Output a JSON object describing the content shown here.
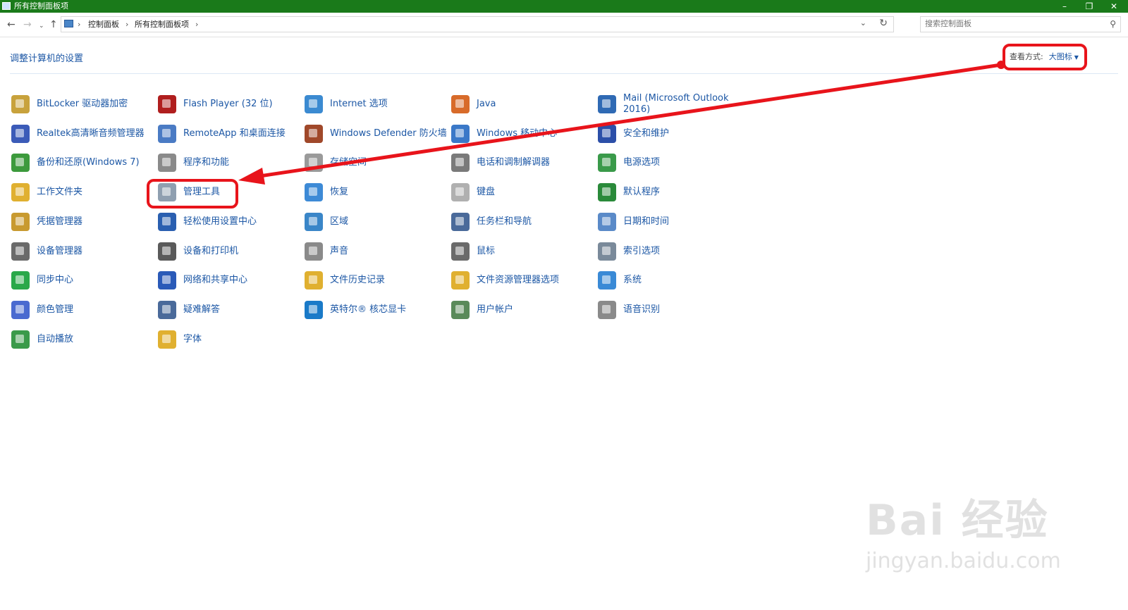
{
  "window": {
    "title": "所有控制面板项"
  },
  "address": {
    "crumbs": [
      "控制面板",
      "所有控制面板项"
    ],
    "separator": "›"
  },
  "search": {
    "placeholder": "搜索控制面板"
  },
  "header": {
    "heading": "调整计算机的设置",
    "view_by_label": "查看方式:",
    "view_by_value": "大图标"
  },
  "items": [
    {
      "label": "BitLocker 驱动器加密",
      "icon": "bitlocker-icon",
      "color": "#c8a23c"
    },
    {
      "label": "Flash Player (32 位)",
      "icon": "flash-icon",
      "color": "#b01e1e"
    },
    {
      "label": "Internet 选项",
      "icon": "internet-options-icon",
      "color": "#3b8ad1"
    },
    {
      "label": "Java",
      "icon": "java-icon",
      "color": "#d86b2a"
    },
    {
      "label": "Mail (Microsoft Outlook 2016)",
      "icon": "mail-icon",
      "color": "#2f6ab4"
    },
    {
      "label": "Realtek高清晰音频管理器",
      "icon": "realtek-audio-icon",
      "color": "#3b5bb8"
    },
    {
      "label": "RemoteApp 和桌面连接",
      "icon": "remoteapp-icon",
      "color": "#4a7bc4"
    },
    {
      "label": "Windows Defender 防火墙",
      "icon": "firewall-icon",
      "color": "#a0482a"
    },
    {
      "label": "Windows 移动中心",
      "icon": "mobility-center-icon",
      "color": "#3a78c8"
    },
    {
      "label": "安全和维护",
      "icon": "security-flag-icon",
      "color": "#2c4fa8"
    },
    {
      "label": "备份和还原(Windows 7)",
      "icon": "backup-icon",
      "color": "#3c9a3c"
    },
    {
      "label": "程序和功能",
      "icon": "programs-icon",
      "color": "#8a8a8a"
    },
    {
      "label": "存储空间",
      "icon": "storage-spaces-icon",
      "color": "#9a9a9a"
    },
    {
      "label": "电话和调制解调器",
      "icon": "phone-modem-icon",
      "color": "#7a7a7a"
    },
    {
      "label": "电源选项",
      "icon": "power-options-icon",
      "color": "#3a9a4a"
    },
    {
      "label": "工作文件夹",
      "icon": "work-folders-icon",
      "color": "#e0b030"
    },
    {
      "label": "管理工具",
      "icon": "admin-tools-icon",
      "color": "#8f9fb0"
    },
    {
      "label": "恢复",
      "icon": "recovery-icon",
      "color": "#3d8ad6"
    },
    {
      "label": "键盘",
      "icon": "keyboard-icon",
      "color": "#b0b0b0"
    },
    {
      "label": "默认程序",
      "icon": "default-programs-icon",
      "color": "#2a8a3a"
    },
    {
      "label": "凭据管理器",
      "icon": "credential-manager-icon",
      "color": "#c89a30"
    },
    {
      "label": "轻松使用设置中心",
      "icon": "ease-of-access-icon",
      "color": "#2a5fb0"
    },
    {
      "label": "区域",
      "icon": "region-icon",
      "color": "#3a86c8"
    },
    {
      "label": "任务栏和导航",
      "icon": "taskbar-icon",
      "color": "#4a6a9a"
    },
    {
      "label": "日期和时间",
      "icon": "date-time-icon",
      "color": "#5a8ac8"
    },
    {
      "label": "设备管理器",
      "icon": "device-manager-icon",
      "color": "#6a6a6a"
    },
    {
      "label": "设备和打印机",
      "icon": "printer-icon",
      "color": "#5a5a5a"
    },
    {
      "label": "声音",
      "icon": "sound-icon",
      "color": "#8a8a8a"
    },
    {
      "label": "鼠标",
      "icon": "mouse-icon",
      "color": "#6a6a6a"
    },
    {
      "label": "索引选项",
      "icon": "indexing-icon",
      "color": "#7a8a9a"
    },
    {
      "label": "同步中心",
      "icon": "sync-center-icon",
      "color": "#2aa84a"
    },
    {
      "label": "网络和共享中心",
      "icon": "network-icon",
      "color": "#2a5ab8"
    },
    {
      "label": "文件历史记录",
      "icon": "file-history-icon",
      "color": "#e0b030"
    },
    {
      "label": "文件资源管理器选项",
      "icon": "explorer-options-icon",
      "color": "#e0b030"
    },
    {
      "label": "系统",
      "icon": "system-icon",
      "color": "#3a8ad6"
    },
    {
      "label": "颜色管理",
      "icon": "color-management-icon",
      "color": "#4a6ad0"
    },
    {
      "label": "疑难解答",
      "icon": "troubleshooting-icon",
      "color": "#4a6a9a"
    },
    {
      "label": "英特尔® 核芯显卡",
      "icon": "intel-graphics-icon",
      "color": "#1a7ac8"
    },
    {
      "label": "用户帐户",
      "icon": "user-accounts-icon",
      "color": "#5a8a5a"
    },
    {
      "label": "语音识别",
      "icon": "microphone-icon",
      "color": "#8a8a8a"
    },
    {
      "label": "自动播放",
      "icon": "autoplay-icon",
      "color": "#3a9a4a"
    },
    {
      "label": "字体",
      "icon": "fonts-icon",
      "color": "#e0b030"
    }
  ],
  "watermark": {
    "brand": "Bai 经验",
    "url": "jingyan.baidu.com"
  },
  "annotation_color": "#e8141b"
}
